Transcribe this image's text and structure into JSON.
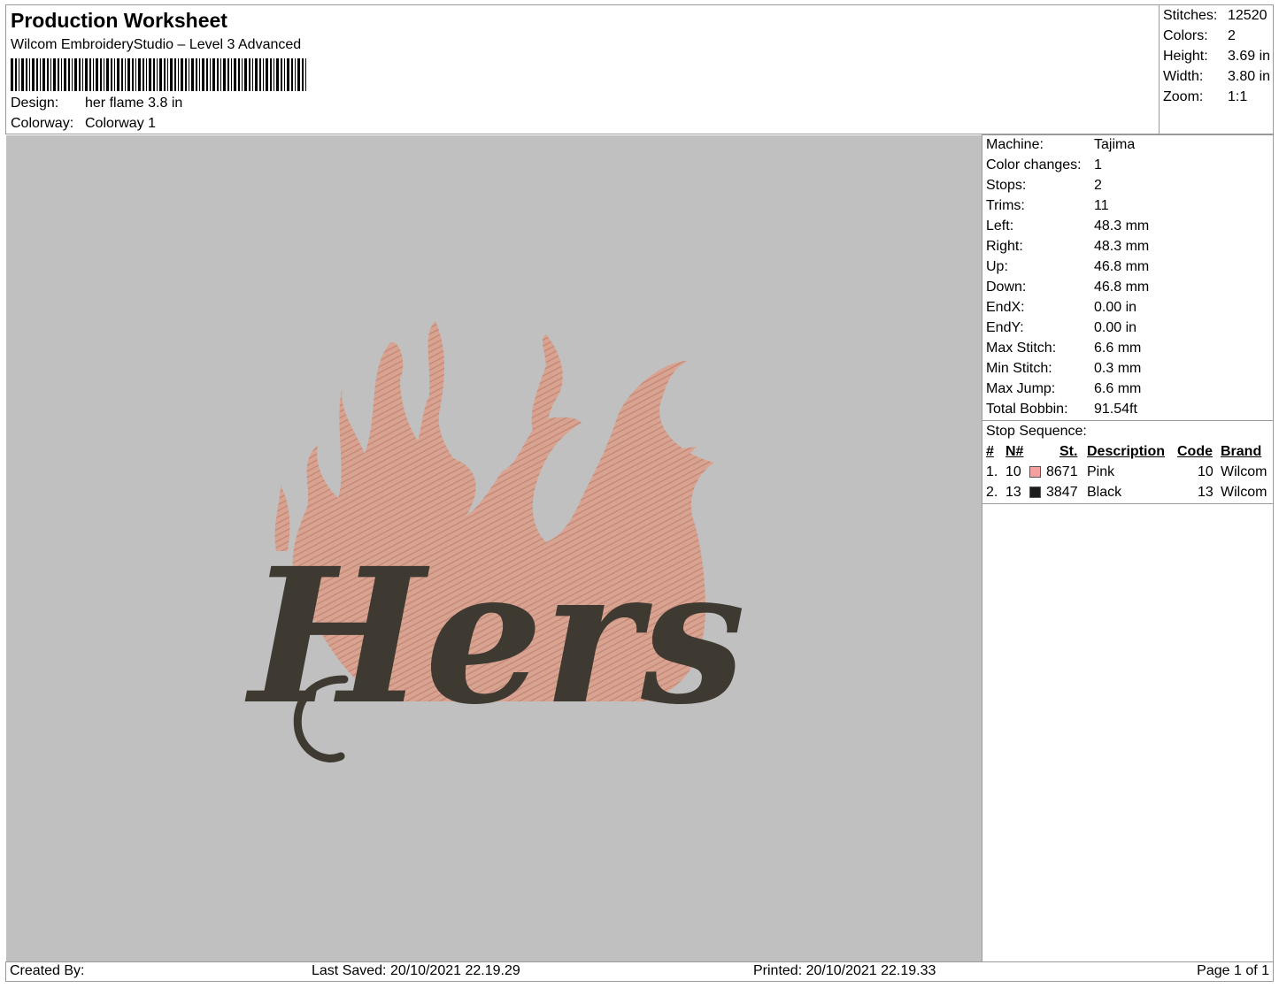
{
  "header": {
    "title": "Production Worksheet",
    "software": "Wilcom EmbroideryStudio – Level 3 Advanced",
    "design_label": "Design:",
    "design_value": "her flame 3.8 in",
    "colorway_label": "Colorway:",
    "colorway_value": "Colorway 1"
  },
  "stats": [
    {
      "label": "Stitches:",
      "value": "12520"
    },
    {
      "label": "Colors:",
      "value": "2"
    },
    {
      "label": "Height:",
      "value": "3.69 in"
    },
    {
      "label": "Width:",
      "value": "3.80 in"
    },
    {
      "label": "Zoom:",
      "value": "1:1"
    }
  ],
  "machine_info": [
    {
      "label": "Machine:",
      "value": "Tajima"
    },
    {
      "label": "Color changes:",
      "value": "1"
    },
    {
      "label": "Stops:",
      "value": "2"
    },
    {
      "label": "Trims:",
      "value": "11"
    },
    {
      "label": "Left:",
      "value": "48.3 mm"
    },
    {
      "label": "Right:",
      "value": "48.3 mm"
    },
    {
      "label": "Up:",
      "value": "46.8 mm"
    },
    {
      "label": "Down:",
      "value": "46.8 mm"
    },
    {
      "label": "EndX:",
      "value": "0.00 in"
    },
    {
      "label": "EndY:",
      "value": "0.00 in"
    },
    {
      "label": "Max Stitch:",
      "value": "6.6 mm"
    },
    {
      "label": "Min Stitch:",
      "value": "0.3 mm"
    },
    {
      "label": "Max Jump:",
      "value": "6.6 mm"
    },
    {
      "label": "Total Bobbin:",
      "value": "91.54ft"
    }
  ],
  "stop_sequence": {
    "title": "Stop Sequence:",
    "headers": {
      "num": "#",
      "n": "N#",
      "st": "St.",
      "description": "Description",
      "code": "Code",
      "brand": "Brand"
    },
    "rows": [
      {
        "num": "1.",
        "n": "10",
        "color": "#f2a0a0",
        "st": "8671",
        "description": "Pink",
        "code": "10",
        "brand": "Wilcom"
      },
      {
        "num": "2.",
        "n": "13",
        "color": "#1e1c1a",
        "st": "3847",
        "description": "Black",
        "code": "13",
        "brand": "Wilcom"
      }
    ]
  },
  "design": {
    "text": "Hers",
    "flame_color": "#d9a392",
    "text_color": "#3e3a32",
    "background": "#c0c0c0"
  },
  "footer": {
    "created_by": "Created By:",
    "last_saved": "Last Saved: 20/10/2021 22.19.29",
    "printed": "Printed: 20/10/2021 22.19.33",
    "page": "Page 1 of 1"
  }
}
